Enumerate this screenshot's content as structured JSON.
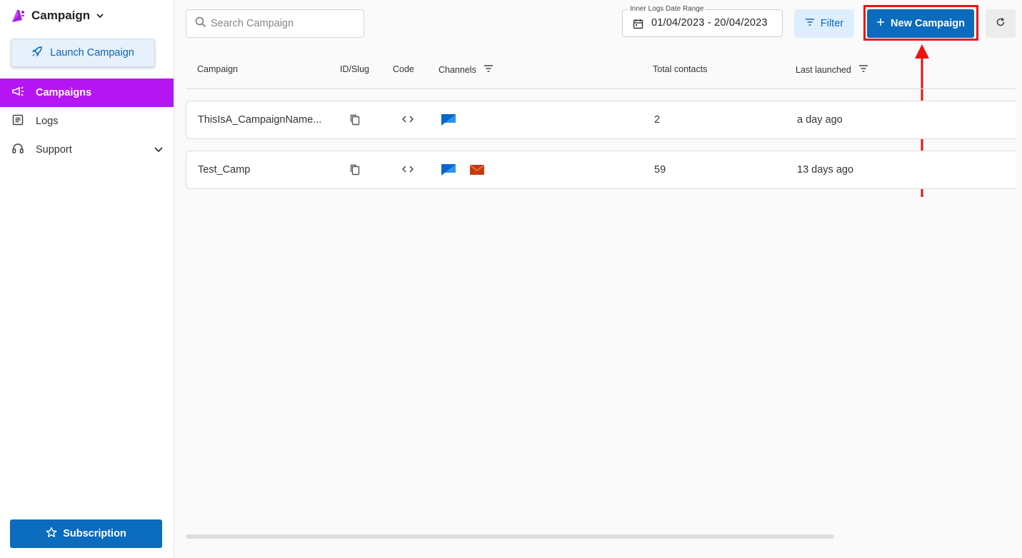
{
  "app": {
    "title": "Campaign"
  },
  "sidebar": {
    "launch_label": "Launch Campaign",
    "items": [
      {
        "label": "Campaigns",
        "icon": "megaphone-icon",
        "active": true
      },
      {
        "label": "Logs",
        "icon": "document-icon",
        "active": false
      },
      {
        "label": "Support",
        "icon": "headset-icon",
        "active": false
      }
    ],
    "subscription_label": "Subscription"
  },
  "toolbar": {
    "search_placeholder": "Search Campaign",
    "date_range_label": "Inner Logs Date Range",
    "date_range_value": "01/04/2023 - 20/04/2023",
    "filter_label": "Filter",
    "new_campaign_label": "New Campaign"
  },
  "table": {
    "columns": [
      "Campaign",
      "ID/Slug",
      "Code",
      "Channels",
      "Total contacts",
      "Last launched"
    ],
    "rows": [
      {
        "name": "ThisIsA_CampaignName...",
        "channels": [
          "blue-chat-icon"
        ],
        "total_contacts": "2",
        "last_launched": "a day ago"
      },
      {
        "name": "Test_Camp",
        "channels": [
          "blue-chat-icon",
          "red-mail-icon"
        ],
        "total_contacts": "59",
        "last_launched": "13 days ago"
      }
    ]
  },
  "colors": {
    "accent": "#b515f2",
    "primary": "#0b6bbd",
    "highlight": "#ee1111"
  }
}
